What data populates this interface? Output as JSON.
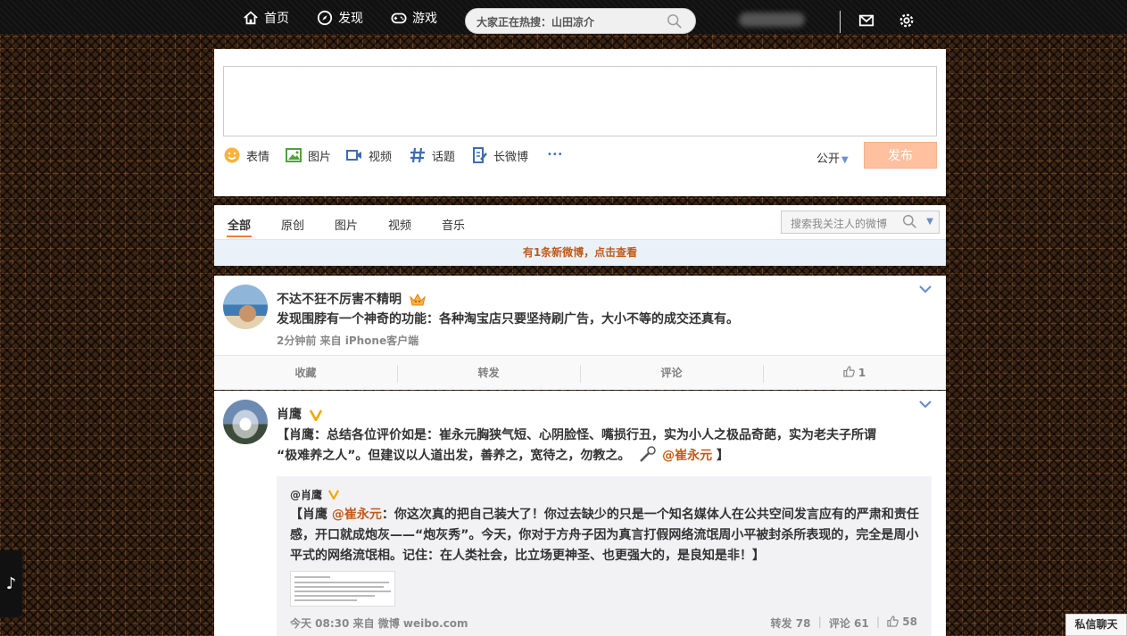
{
  "nav": {
    "home": "首页",
    "discover": "发现",
    "games": "游戏",
    "search_placeholder": "大家正在热搜：山田凉介"
  },
  "composer": {
    "tools": [
      "表情",
      "图片",
      "视频",
      "话题",
      "长微博"
    ],
    "more": "•••",
    "visibility": "公开",
    "publish": "发布"
  },
  "feed_tabs": {
    "tabs": [
      "全部",
      "原创",
      "图片",
      "视频",
      "音乐"
    ],
    "search_placeholder": "搜索我关注人的微博",
    "new_banner": "有1条新微博，点击查看"
  },
  "post1": {
    "author": "不达不狂不厉害不精明",
    "text": "发现围脖有一个神奇的功能：各种淘宝店只要坚持刷广告，大小不等的成交还真有。",
    "meta": "2分钟前 来自 iPhone客户端",
    "actions": {
      "favorite": "收藏",
      "repost": "转发",
      "comment": "评论",
      "like": "1"
    }
  },
  "post2": {
    "author": "肖鹰",
    "line1": "【肖鹰：总结各位评价如是：崔永元胸狭气短、心阴脸怪、嘴损行丑，实为小人之极品奇葩，实为老夫子所谓",
    "line2": "“极难养之人”。但建议以人道出发，善养之，宽待之，勿教之。",
    "mention": "@崔永元",
    "close": " 】",
    "repost": {
      "author": "@肖鹰",
      "prefix": "【肖鹰 ",
      "mention": "@崔永元",
      "text": "：你这次真的把自己装大了！你过去缺少的只是一个知名媒体人在公共空间发言应有的严肃和责任感，开口就成炮灰——“炮灰秀”。今天，你对于方舟子因为真言打假网络流氓周小平被封杀所表现的，完全是周小平式的网络流氓相。记住：在人类社会，比立场更神圣、也更强大的，是良知是非！】",
      "meta": "今天 08:30 来自 微博 weibo.com",
      "reposts": "转发 78",
      "comments": "评论 61",
      "likes": "58"
    }
  },
  "side": {
    "chat": "私信聊天",
    "music": "♪"
  },
  "colors": {
    "accent_orange": "#fa7d3c",
    "publish_disabled": "#ffc09f",
    "link": "#c05b1c"
  }
}
